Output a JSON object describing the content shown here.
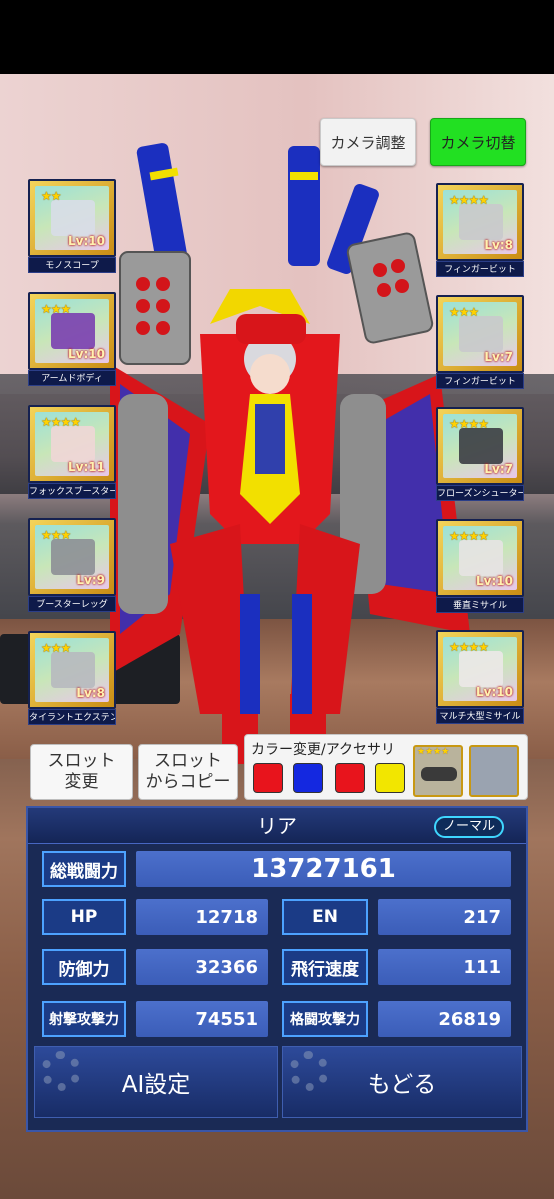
{
  "camera": {
    "adjust_label": "カメラ調整",
    "switch_label": "カメラ切替"
  },
  "slots_left": [
    {
      "name": "モノスコープ",
      "level": "Lv:10",
      "stars": "★★"
    },
    {
      "name": "アームドボディ",
      "level": "Lv:10",
      "stars": "★★★"
    },
    {
      "name": "フォックスブースター",
      "level": "Lv:11",
      "stars": "★★★★"
    },
    {
      "name": "ブースターレッグ",
      "level": "Lv:9",
      "stars": "★★★"
    },
    {
      "name": "タイラントエクステンションII",
      "level": "Lv:8",
      "stars": "★★★"
    }
  ],
  "slots_right": [
    {
      "name": "フィンガービット",
      "level": "Lv:8",
      "stars": "★★★★"
    },
    {
      "name": "フィンガービット",
      "level": "Lv:7",
      "stars": "★★★"
    },
    {
      "name": "フローズンシューター",
      "level": "Lv:7",
      "stars": "★★★★"
    },
    {
      "name": "垂直ミサイル",
      "level": "Lv:10",
      "stars": "★★★★"
    },
    {
      "name": "マルチ大型ミサイル",
      "level": "Lv:10",
      "stars": "★★★★"
    }
  ],
  "slot_controls": {
    "change_label": "スロット\n変更",
    "copy_label": "スロット\nからコピー"
  },
  "color_panel": {
    "title": "カラー変更/アクセサリ",
    "swatches": [
      "#e8141c",
      "#1428e0",
      "#e8141c",
      "#f2e600"
    ],
    "accessory_stars": "★★★★"
  },
  "status": {
    "name": "リア",
    "mode_badge": "ノーマル",
    "total_label": "総戦闘力",
    "total_value": "13727161",
    "stats": [
      {
        "label": "HP",
        "value": "12718"
      },
      {
        "label": "EN",
        "value": "217"
      },
      {
        "label": "防御力",
        "value": "32366"
      },
      {
        "label": "飛行速度",
        "value": "111"
      },
      {
        "label": "射撃攻撃力",
        "value": "74551"
      },
      {
        "label": "格闘攻撃力",
        "value": "26819"
      }
    ]
  },
  "actions": {
    "ai_label": "AI設定",
    "back_label": "もどる"
  }
}
